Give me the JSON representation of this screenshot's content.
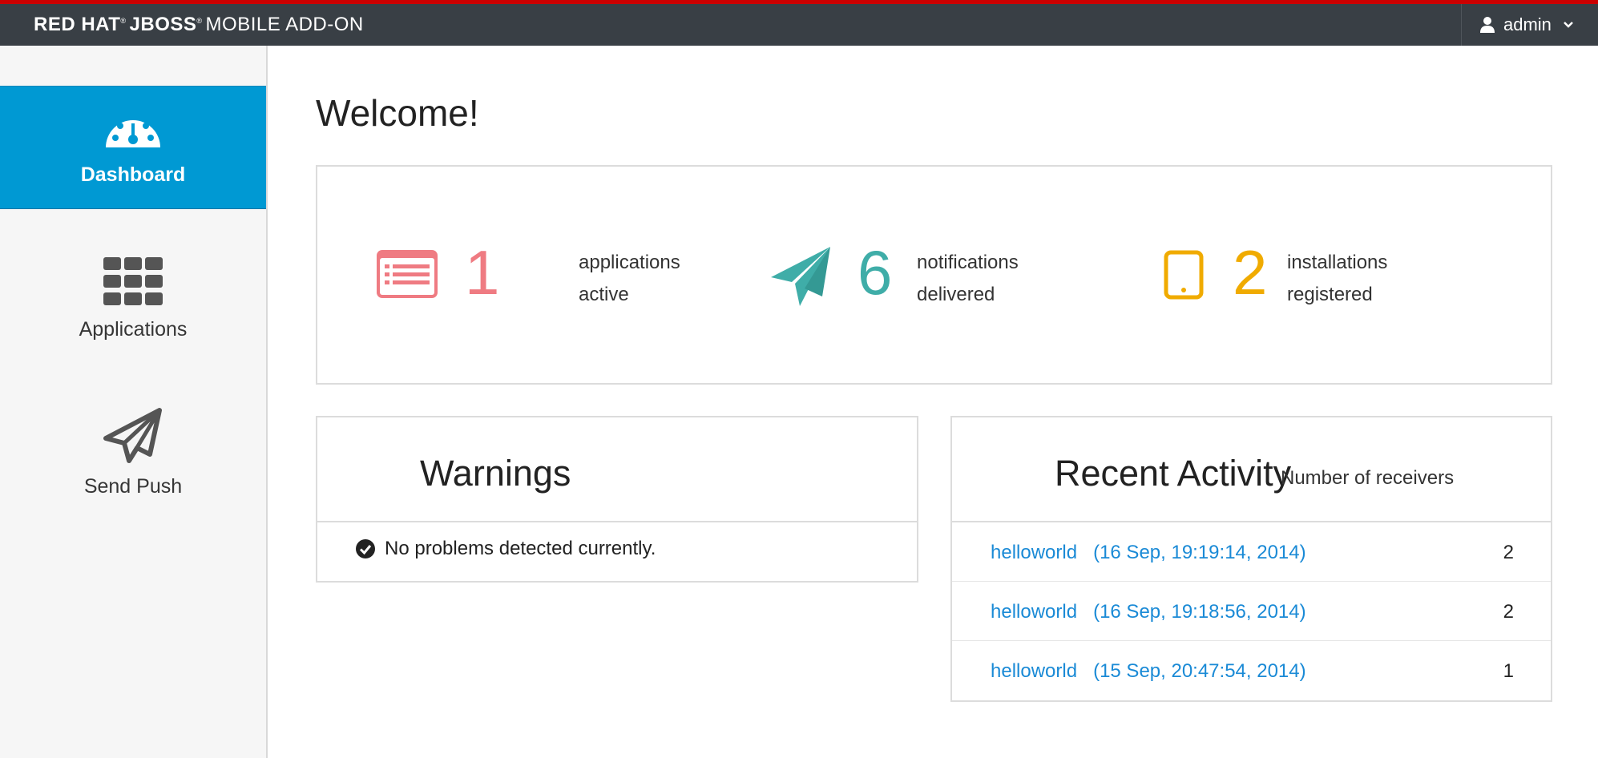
{
  "header": {
    "brand_redhat": "RED HAT",
    "brand_jboss": "JBOSS",
    "brand_rest": "MOBILE ADD-ON",
    "user_label": "admin",
    "icons": {
      "user": "user-icon",
      "menu": "chevron-down-icon"
    }
  },
  "sidebar": {
    "items": [
      {
        "label": "Dashboard",
        "icon": "dashboard-gauge-icon",
        "active": true
      },
      {
        "label": "Applications",
        "icon": "grid-icon",
        "active": false
      },
      {
        "label": "Send Push",
        "icon": "paper-plane-icon",
        "active": false
      }
    ]
  },
  "main": {
    "title": "Welcome!",
    "stats": [
      {
        "value": "1",
        "line1": "applications",
        "line2": "active",
        "icon": "list-card-icon",
        "color": "#ef7b82"
      },
      {
        "value": "6",
        "line1": "notifications",
        "line2": "delivered",
        "icon": "paper-plane-icon",
        "color": "#3fada8"
      },
      {
        "value": "2",
        "line1": "installations",
        "line2": "registered",
        "icon": "tablet-icon",
        "color": "#f0ab00"
      }
    ],
    "warnings": {
      "title": "Warnings",
      "message": "No problems detected currently.",
      "icon": "check-circle-icon"
    },
    "activity": {
      "title": "Recent Activity",
      "column_header": "Number of receivers",
      "rows": [
        {
          "app": "helloworld",
          "time": "(16 Sep, 19:19:14, 2014)",
          "receivers": "2"
        },
        {
          "app": "helloworld",
          "time": "(16 Sep, 19:18:56, 2014)",
          "receivers": "2"
        },
        {
          "app": "helloworld",
          "time": "(15 Sep, 20:47:54, 2014)",
          "receivers": "1"
        }
      ]
    }
  },
  "colors": {
    "topbar": "#393f45",
    "accent_red": "#cc0000",
    "nav_active": "#0099d3",
    "link": "#1a8ad6"
  }
}
